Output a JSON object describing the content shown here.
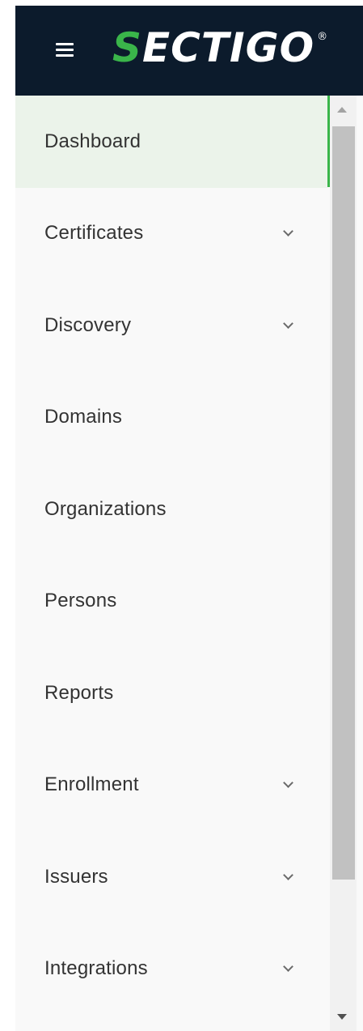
{
  "header": {
    "logo": {
      "first_letter": "S",
      "rest": "ECTIGO",
      "registered_mark": "®"
    },
    "menu_icon": "hamburger-menu-icon"
  },
  "nav": {
    "items": [
      {
        "label": "Dashboard",
        "active": true,
        "expandable": false
      },
      {
        "label": "Certificates",
        "active": false,
        "expandable": true
      },
      {
        "label": "Discovery",
        "active": false,
        "expandable": true
      },
      {
        "label": "Domains",
        "active": false,
        "expandable": false
      },
      {
        "label": "Organizations",
        "active": false,
        "expandable": false
      },
      {
        "label": "Persons",
        "active": false,
        "expandable": false
      },
      {
        "label": "Reports",
        "active": false,
        "expandable": false
      },
      {
        "label": "Enrollment",
        "active": false,
        "expandable": true
      },
      {
        "label": "Issuers",
        "active": false,
        "expandable": true
      },
      {
        "label": "Integrations",
        "active": false,
        "expandable": true
      }
    ],
    "expand_icon": "chevron-down-icon"
  },
  "colors": {
    "header_bg": "#0c1b2c",
    "brand_green": "#3ab54a",
    "active_bg": "#ebf3ea",
    "nav_bg": "#f9f9f9",
    "text": "#333333"
  }
}
